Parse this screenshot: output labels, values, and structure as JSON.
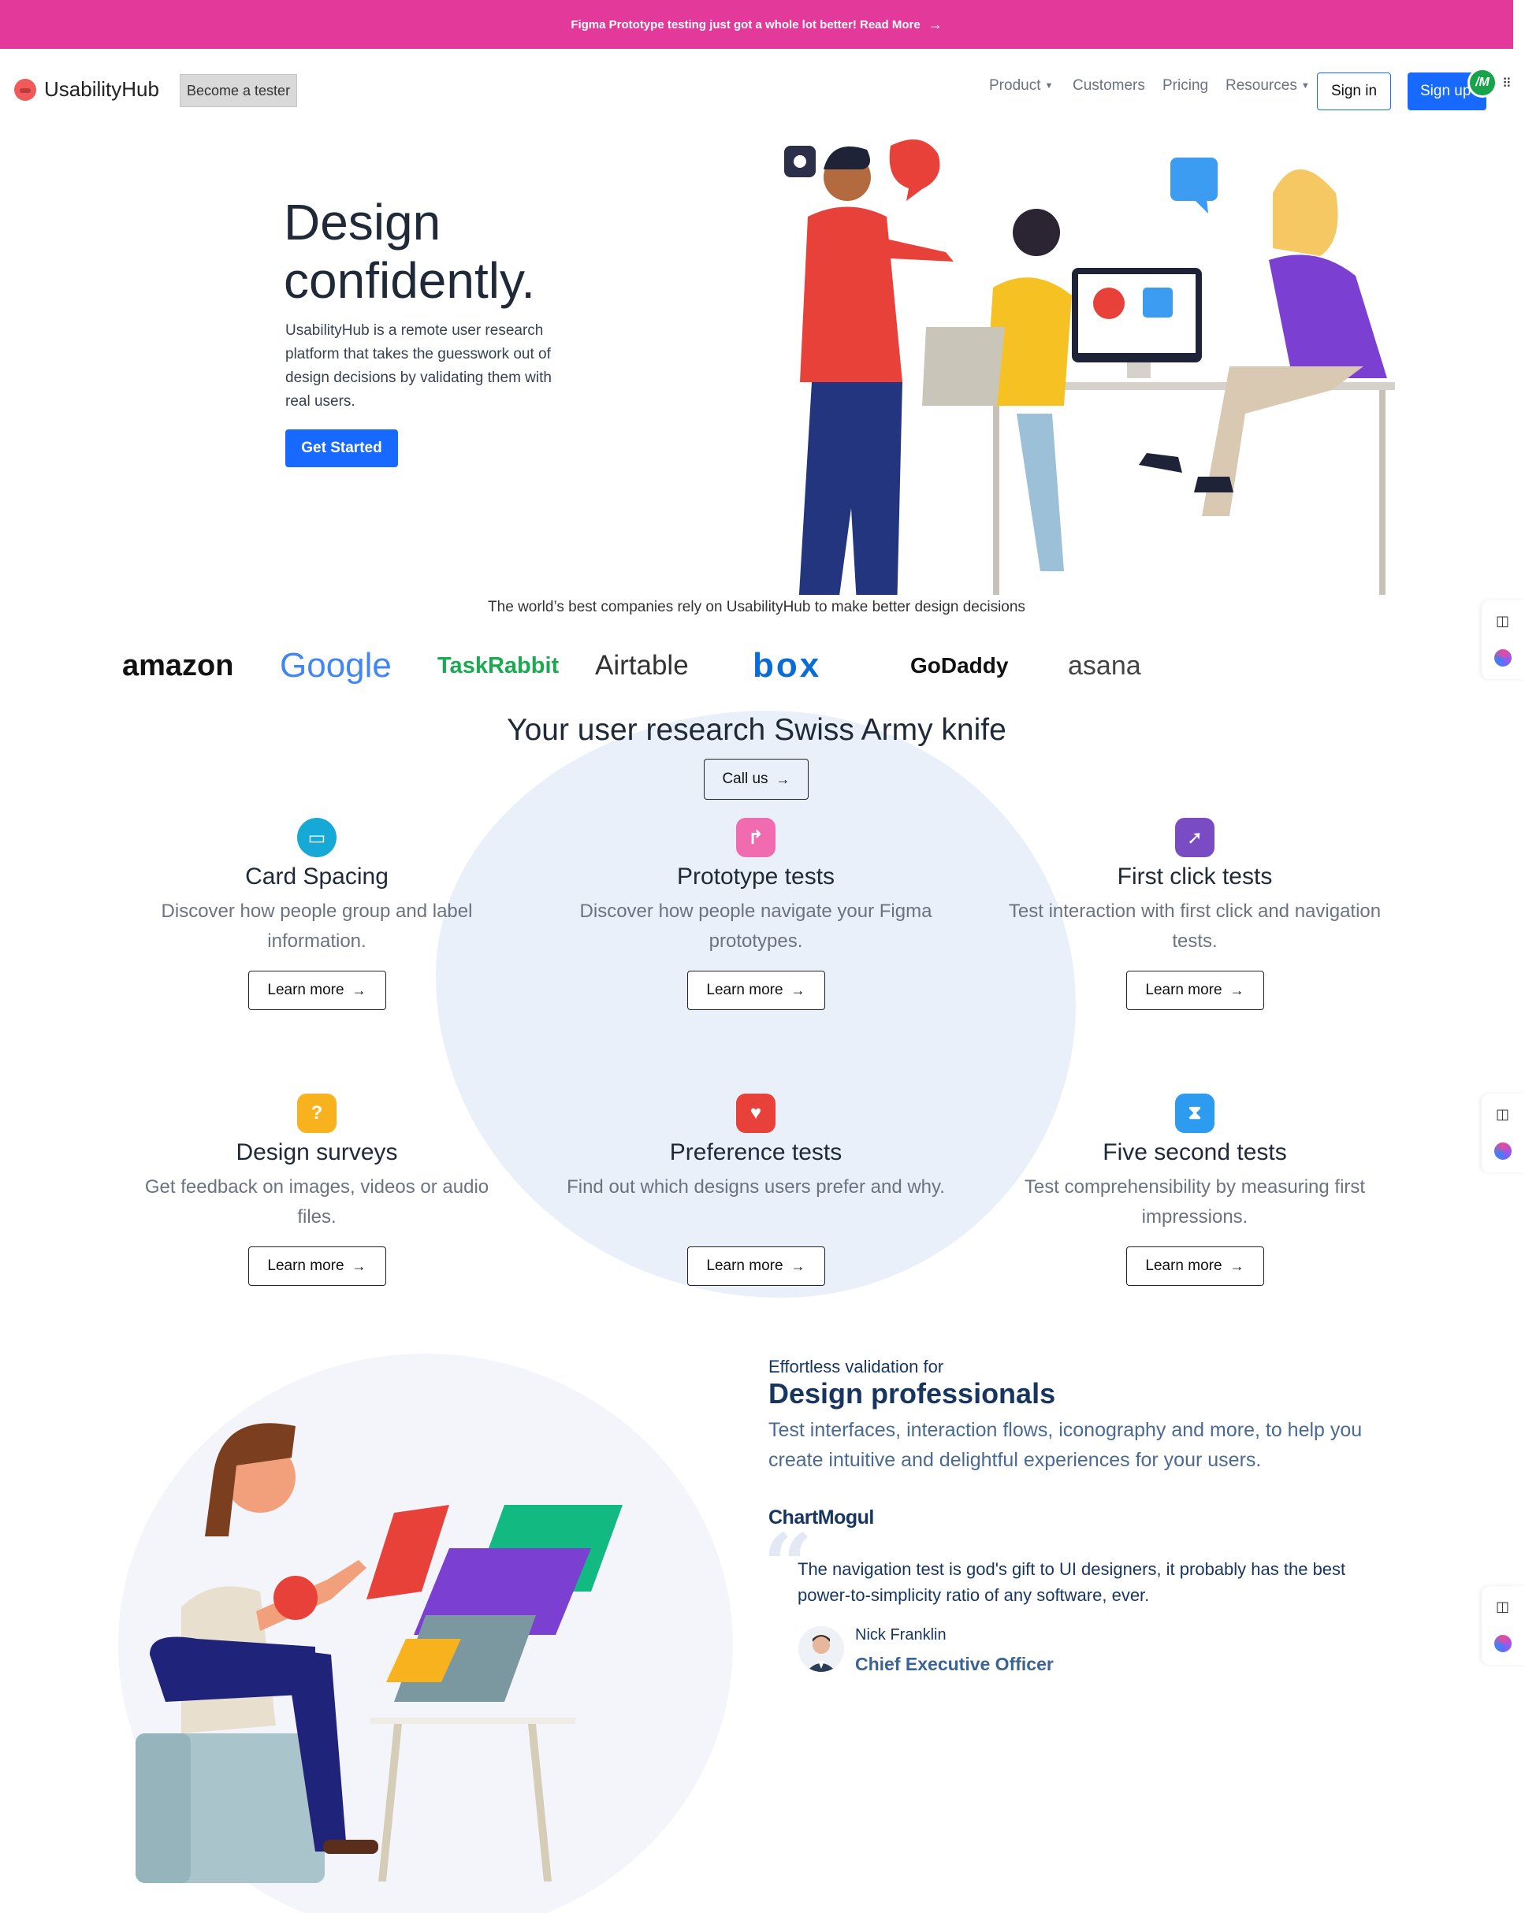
{
  "announcement": {
    "text": "Figma Prototype testing just got a whole lot better! Read More",
    "icon": "arrow-right-icon"
  },
  "nav": {
    "logo_text": "UsabilityHub",
    "become_tester": "Become a tester",
    "items": [
      {
        "label": "Product",
        "has_dropdown": true
      },
      {
        "label": "Customers",
        "has_dropdown": false
      },
      {
        "label": "Pricing",
        "has_dropdown": false
      },
      {
        "label": "Resources",
        "has_dropdown": true
      }
    ],
    "sign_in": "Sign in",
    "sign_up": "Sign up",
    "extension_badge": "/M"
  },
  "hero": {
    "title_line1": "Design",
    "title_line2": "confidently.",
    "description": "UsabilityHub is a remote user research platform that takes the guesswork out of design decisions by validating them with real users.",
    "cta": "Get Started"
  },
  "trust": {
    "text": "The world’s best companies rely on UsabilityHub to make better design decisions",
    "companies": [
      "amazon",
      "Google",
      "TaskRabbit",
      "Airtable",
      "box",
      "GoDaddy",
      "asana"
    ]
  },
  "features": {
    "title": "Your user research Swiss Army knife",
    "call_us": "Call us",
    "cards": [
      {
        "title": "Card Spacing",
        "description": "Discover how people group and label information.",
        "button": "Learn more",
        "icon": "card-sort-icon",
        "color": "#17a9d6"
      },
      {
        "title": "Prototype tests",
        "description": "Discover how people navigate your Figma prototypes.",
        "button": "Learn more",
        "icon": "prototype-icon",
        "color": "#f06bb0"
      },
      {
        "title": "First click tests",
        "description": "Test interaction with first click and navigation tests.",
        "button": "Learn more",
        "icon": "cursor-icon",
        "color": "#7a4cc4"
      },
      {
        "title": "Design surveys",
        "description": "Get feedback on images, videos or audio files.",
        "button": "Learn more",
        "icon": "question-icon",
        "color": "#f8b21e"
      },
      {
        "title": "Preference tests",
        "description": "Find out which designs users prefer and why.",
        "button": "Learn more",
        "icon": "heart-icon",
        "color": "#e8413a"
      },
      {
        "title": "Five second tests",
        "description": "Test comprehensibility by measuring first impressions.",
        "button": "Learn more",
        "icon": "hourglass-icon",
        "color": "#2d9bf0"
      }
    ]
  },
  "professionals": {
    "kicker": "Effortless validation for",
    "title": "Design professionals",
    "description": "Test interfaces, interaction flows, iconography and more, to help you create intuitive and delightful experiences for your users.",
    "company": "ChartMogul",
    "quote": "The navigation test is god's gift to UI designers, it probably has the best power-to-simplicity ratio of any software, ever.",
    "person_name": "Nick Franklin",
    "person_role": "Chief Executive Officer"
  }
}
